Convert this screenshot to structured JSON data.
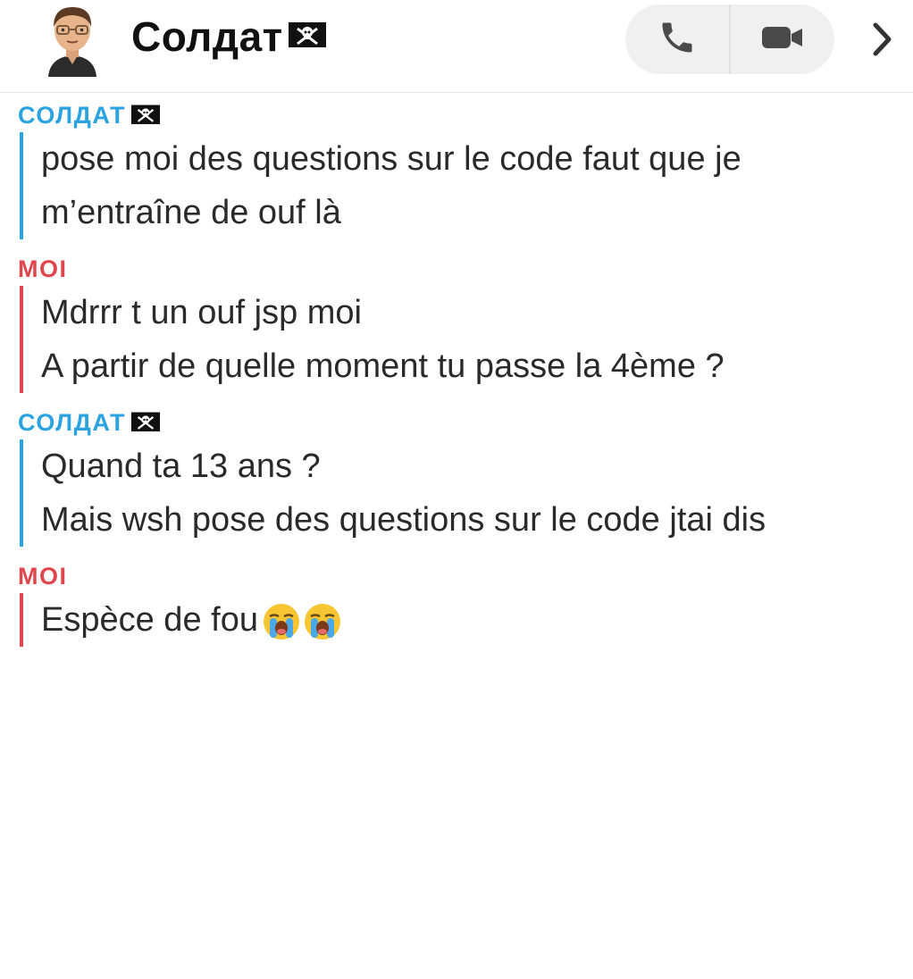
{
  "header": {
    "title": "Солдат",
    "title_flag_icon": "pirate-flag-icon",
    "avatar_icon": "bitmoji-avatar-icon",
    "call_icon": "phone-icon",
    "video_icon": "video-camera-icon",
    "more_icon": "chevron-right-icon"
  },
  "colors": {
    "them": "#2aa3e0",
    "me": "#e0474c",
    "pill_bg": "#f0f0f0",
    "icon": "#4a4a4a"
  },
  "messages": [
    {
      "sender": "СОЛДАТ",
      "from": "them",
      "lines": [
        "pose moi des questions sur le code faut que je",
        "m’entraîne de ouf là"
      ]
    },
    {
      "sender": "MOI",
      "from": "me",
      "lines": [
        "Mdrrr t un ouf jsp moi",
        "A partir de quelle moment tu passe la 4ème ?"
      ]
    },
    {
      "sender": "СОЛДАТ",
      "from": "them",
      "lines": [
        "Quand ta 13 ans ?",
        "Mais wsh pose des questions sur le code jtai dis"
      ]
    },
    {
      "sender": "MOI",
      "from": "me",
      "lines": [
        "Espèce de fou"
      ],
      "emoji": [
        "loudly-crying-face-icon",
        "loudly-crying-face-icon"
      ]
    }
  ]
}
